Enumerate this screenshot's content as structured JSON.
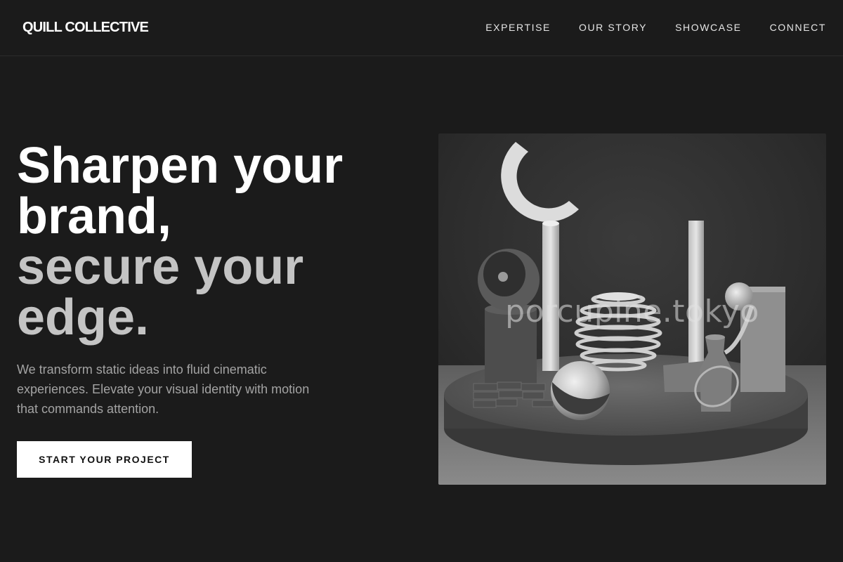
{
  "brand": {
    "name": "QUILL COLLECTIVE"
  },
  "nav": {
    "items": [
      {
        "label": "EXPERTISE"
      },
      {
        "label": "OUR STORY"
      },
      {
        "label": "SHOWCASE"
      },
      {
        "label": "CONNECT"
      }
    ]
  },
  "hero": {
    "title_lines": [
      "Sharpen your",
      "brand,",
      "secure your",
      "edge."
    ],
    "description": "We transform static ideas into fluid cinematic experiences. Elevate your visual identity with motion that commands attention.",
    "cta_label": "START YOUR PROJECT"
  },
  "visual": {
    "watermark": "porcupine.tokyo"
  },
  "colors": {
    "background": "#1b1b1b",
    "text_primary": "#ffffff",
    "text_secondary": "#c4c4c4",
    "text_muted": "#a3a3a3",
    "cta_background": "#ffffff",
    "cta_text": "#111111"
  }
}
